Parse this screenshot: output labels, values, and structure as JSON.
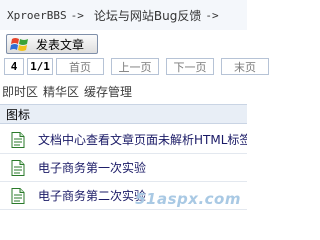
{
  "breadcrumb": {
    "home": "XproerBBS",
    "separator1": "->",
    "item1": "论坛与网站Bug反馈",
    "separator2": "->"
  },
  "toolbar": {
    "post_label": "发表文章"
  },
  "pager": {
    "page_count": "4",
    "current": "1/1",
    "first": "首页",
    "prev": "上一页",
    "next": "下一页",
    "last": "末页"
  },
  "tabs": {
    "recent": "即时区",
    "featured": "精华区",
    "cache": "缓存管理"
  },
  "list_header": {
    "icon_col": "图标"
  },
  "threads": [
    {
      "title": "文档中心查看文章页面未解析HTML标签",
      "icon": "document-icon"
    },
    {
      "title": "电子商务第一次实验",
      "icon": "document-icon"
    },
    {
      "title": "电子商务第二次实验",
      "icon": "document-icon"
    }
  ],
  "watermark": "51aspx.com",
  "colors": {
    "link": "#1a1a66",
    "header_bg": "#e8eef6",
    "border": "#b6c3d6"
  }
}
